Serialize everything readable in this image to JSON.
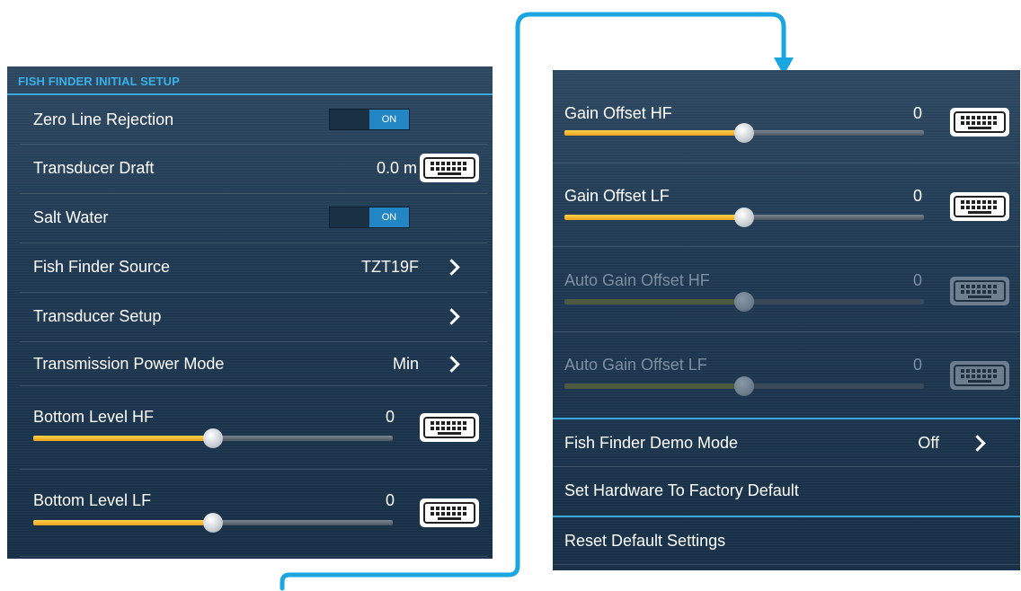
{
  "left_panel": {
    "title": "FISH FINDER INITIAL SETUP",
    "rows": [
      {
        "label": "Zero Line Rejection",
        "toggle": "ON"
      },
      {
        "label": "Transducer Draft",
        "value": "0.0 m"
      },
      {
        "label": "Salt Water",
        "toggle": "ON"
      },
      {
        "label": "Fish Finder Source",
        "value": "TZT19F"
      },
      {
        "label": "Transducer Setup"
      },
      {
        "label": "Transmission Power Mode",
        "value": "Min"
      },
      {
        "label": "Bottom Level HF",
        "value": "0",
        "slider": 0.5
      },
      {
        "label": "Bottom Level LF",
        "value": "0",
        "slider": 0.5
      }
    ]
  },
  "right_panel": {
    "rows": [
      {
        "label": "Gain Offset HF",
        "value": "0",
        "slider": 0.5
      },
      {
        "label": "Gain Offset LF",
        "value": "0",
        "slider": 0.5
      },
      {
        "label": "Auto Gain Offset HF",
        "value": "0",
        "slider": 0.5,
        "disabled": true
      },
      {
        "label": "Auto Gain Offset LF",
        "value": "0",
        "slider": 0.5,
        "disabled": true
      },
      {
        "label": "Fish Finder Demo Mode",
        "value": "Off"
      },
      {
        "label": "Set Hardware To Factory Default"
      },
      {
        "label": "Reset Default Settings"
      }
    ]
  },
  "colors": {
    "accent": "#3aa8dc",
    "slider_fill": "#f0b428",
    "toggle_on": "#2285c4",
    "connector": "#1aa6e0"
  },
  "icons": {
    "keyboard": "keyboard-icon",
    "chevron": "chevron-right-icon"
  }
}
